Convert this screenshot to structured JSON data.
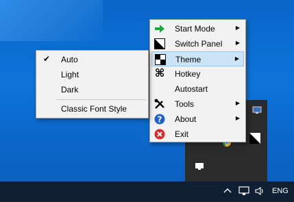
{
  "main_menu": {
    "items": [
      {
        "label": "Start Mode",
        "icon": "green-arrow-icon",
        "submenu": true
      },
      {
        "label": "Switch Panel",
        "icon": "contrast-triangle-icon",
        "submenu": true
      },
      {
        "label": "Theme",
        "icon": "checkerboard-icon",
        "submenu": true,
        "highlighted": true
      },
      {
        "label": "Hotkey",
        "icon": "command-key-icon",
        "submenu": false
      },
      {
        "label": "Autostart",
        "icon": "",
        "submenu": false
      },
      {
        "label": "Tools",
        "icon": "tools-icon",
        "submenu": true
      },
      {
        "label": "About",
        "icon": "help-icon",
        "submenu": true
      },
      {
        "label": "Exit",
        "icon": "exit-icon",
        "submenu": false
      }
    ]
  },
  "theme_submenu": {
    "items": [
      {
        "label": "Auto",
        "checked": true
      },
      {
        "label": "Light",
        "checked": false
      },
      {
        "label": "Dark",
        "checked": false
      },
      {
        "label": "Classic Font Style",
        "checked": false
      }
    ]
  },
  "taskbar": {
    "language": "ENG",
    "icons": [
      "chevron-up-icon",
      "network-icon",
      "volume-icon"
    ]
  },
  "colors": {
    "desktop": "#0d73d9",
    "taskbar": "#101f33",
    "menu_bg": "#f2f2f2",
    "highlight": "#cce4f7"
  }
}
